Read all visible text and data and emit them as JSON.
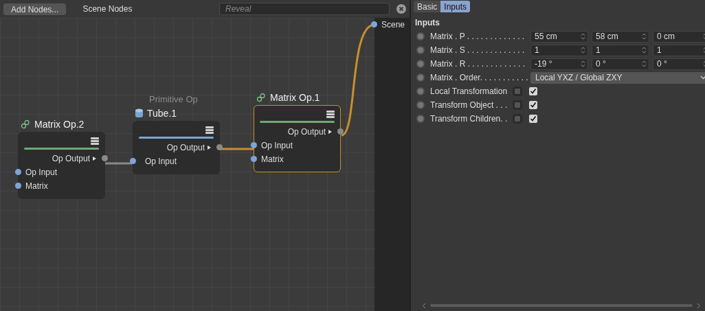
{
  "toolbar": {
    "add_button": "Add Nodes...",
    "title": "Scene Nodes",
    "search": {
      "placeholder": "Reveal"
    }
  },
  "nodes": [
    {
      "kind": "matrix",
      "title": "Matrix Op.2",
      "selected": false,
      "outputs": [
        "Op Output"
      ],
      "inputs": [
        "Op Input",
        "Matrix"
      ]
    },
    {
      "kind": "primitive",
      "subtitle": "Primitive Op",
      "title": "Tube.1",
      "selected": false,
      "outputs": [
        "Op Output"
      ],
      "inputs": [
        "Op Input"
      ]
    },
    {
      "kind": "matrix",
      "title": "Matrix Op.1",
      "selected": true,
      "outputs": [
        "Op Output"
      ],
      "inputs": [
        "Op Input",
        "Matrix"
      ]
    }
  ],
  "scene_port": "Scene",
  "tabs": [
    {
      "label": "Basic",
      "selected": false
    },
    {
      "label": "Inputs",
      "selected": true
    }
  ],
  "section": "Inputs",
  "rows": [
    {
      "kind": "vector",
      "label": "Matrix . P . . . . . . . . . . . . .",
      "values": [
        "55 cm",
        "58 cm",
        "0 cm"
      ]
    },
    {
      "kind": "vector",
      "label": "Matrix . S . . . . . . . . . . . . .",
      "values": [
        "1",
        "1",
        "1"
      ]
    },
    {
      "kind": "vector",
      "label": "Matrix . R . . . . . . . . . . . . .",
      "values": [
        "-19 °",
        "0 °",
        "0 °"
      ]
    },
    {
      "kind": "dropdown",
      "label": "Matrix . Order. . . . . . . . . . .",
      "value": "Local YXZ / Global ZXY"
    },
    {
      "kind": "checkbox",
      "label": "Local Transformation",
      "checked": true
    },
    {
      "kind": "checkbox",
      "label": "Transform Object . . .",
      "checked": true
    },
    {
      "kind": "checkbox",
      "label": "Transform Children. .",
      "checked": true
    }
  ]
}
